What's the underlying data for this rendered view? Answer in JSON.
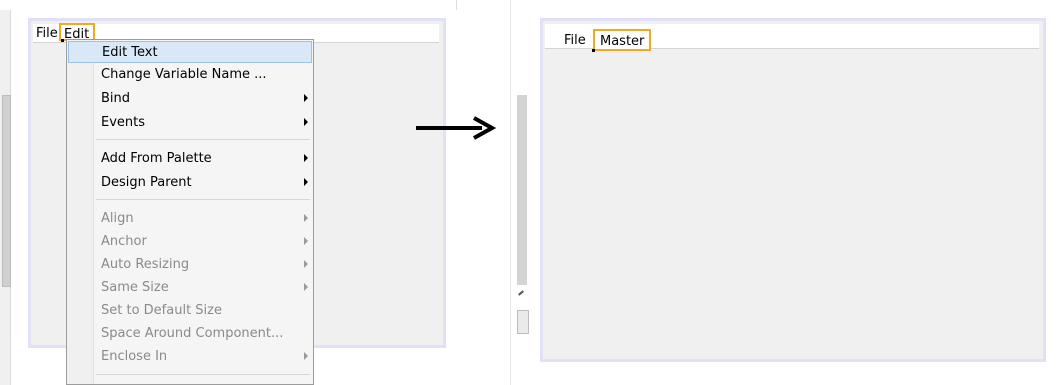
{
  "left": {
    "menubar": {
      "file": "File",
      "edit": "Edit"
    },
    "dropdown": {
      "items": [
        {
          "label": "Edit Text",
          "submenu": false,
          "enabled": true,
          "highlighted": true
        },
        {
          "label": "Change Variable Name ...",
          "submenu": false,
          "enabled": true
        },
        {
          "label": "Bind",
          "submenu": true,
          "enabled": true
        },
        {
          "label": "Events",
          "submenu": true,
          "enabled": true
        },
        {
          "label": "Add From Palette",
          "submenu": true,
          "enabled": true
        },
        {
          "label": "Design Parent",
          "submenu": true,
          "enabled": true
        },
        {
          "label": "Align",
          "submenu": true,
          "enabled": false
        },
        {
          "label": "Anchor",
          "submenu": true,
          "enabled": false
        },
        {
          "label": "Auto Resizing",
          "submenu": true,
          "enabled": false
        },
        {
          "label": "Same Size",
          "submenu": true,
          "enabled": false
        },
        {
          "label": "Set to Default Size",
          "submenu": false,
          "enabled": false
        },
        {
          "label": "Space Around Component...",
          "submenu": false,
          "enabled": false
        },
        {
          "label": "Enclose In",
          "submenu": true,
          "enabled": false
        }
      ]
    }
  },
  "right": {
    "menubar": {
      "file": "File",
      "master": "Master"
    }
  },
  "colors": {
    "highlight_border": "#f5a623",
    "selection": "#d9e8f7",
    "panel_border": "#e0e0f7"
  },
  "icons": {
    "arrow": "right-arrow-icon"
  }
}
